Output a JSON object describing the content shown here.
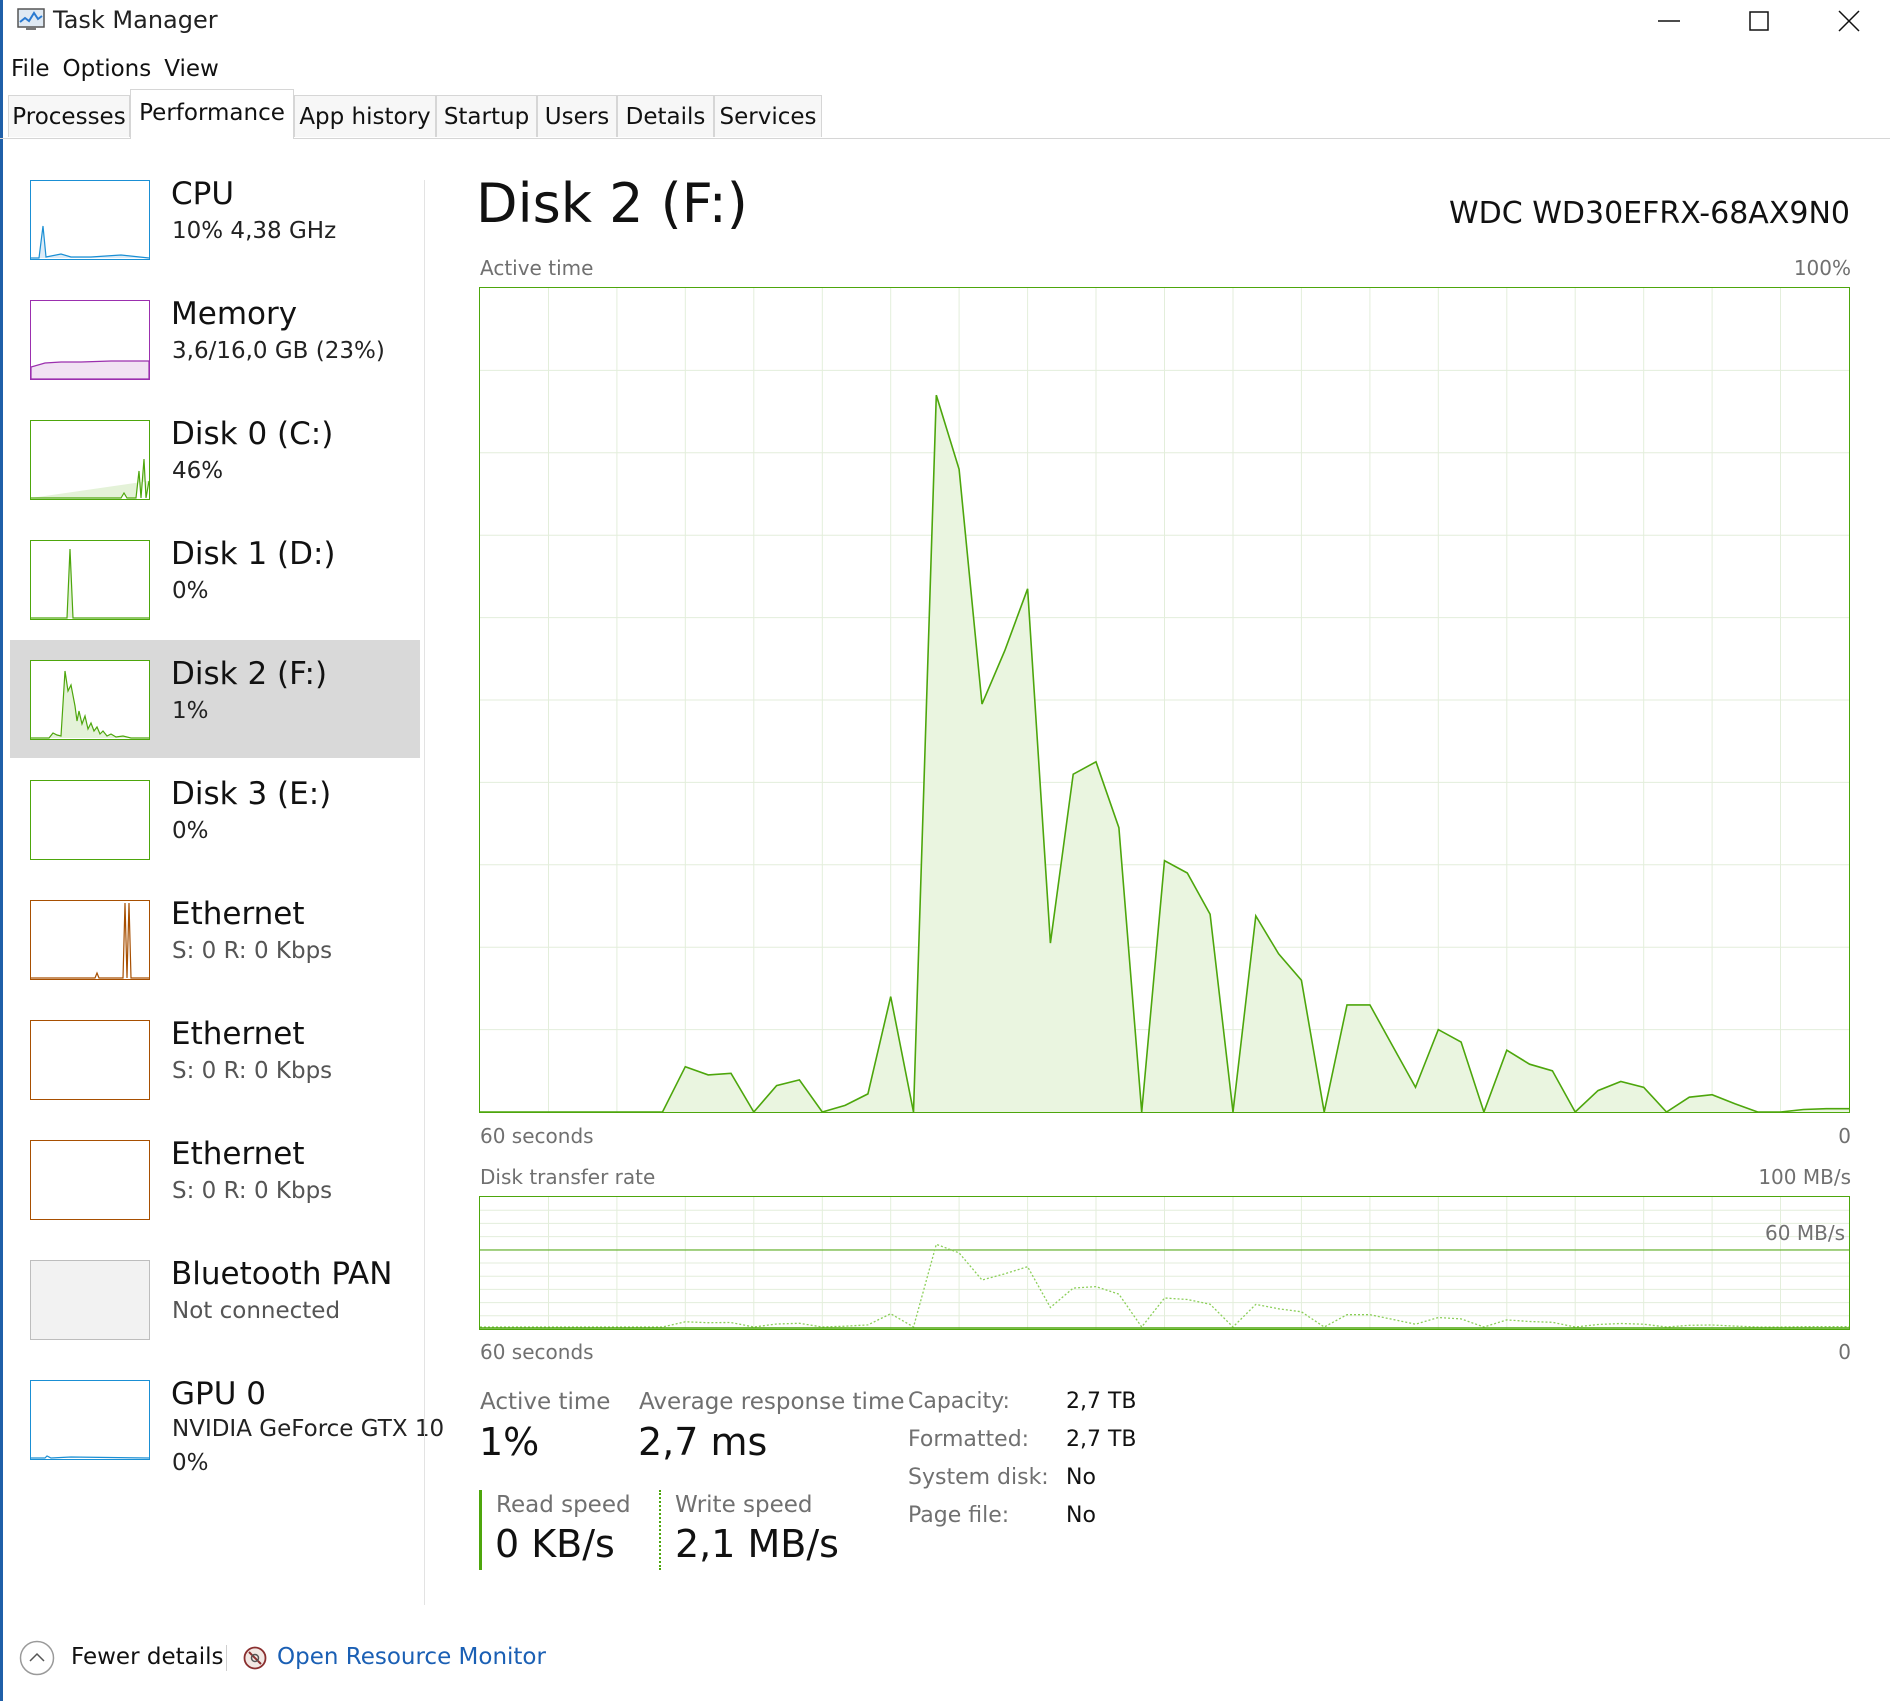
{
  "window": {
    "title": "Task Manager"
  },
  "menu": [
    "File",
    "Options",
    "View"
  ],
  "tabs": [
    {
      "label": "Processes"
    },
    {
      "label": "Performance"
    },
    {
      "label": "App history"
    },
    {
      "label": "Startup"
    },
    {
      "label": "Users"
    },
    {
      "label": "Details"
    },
    {
      "label": "Services"
    }
  ],
  "active_tab": "Performance",
  "sidebar": [
    {
      "name": "CPU",
      "sub": "10%  4,38 GHz",
      "color": "#1a8fd4"
    },
    {
      "name": "Memory",
      "sub": "3,6/16,0 GB (23%)",
      "color": "#9b2fae"
    },
    {
      "name": "Disk 0 (C:)",
      "sub": "46%",
      "color": "#4da60c"
    },
    {
      "name": "Disk 1 (D:)",
      "sub": "0%",
      "color": "#4da60c"
    },
    {
      "name": "Disk 2 (F:)",
      "sub": "1%",
      "color": "#4da60c",
      "selected": true
    },
    {
      "name": "Disk 3 (E:)",
      "sub": "0%",
      "color": "#4da60c"
    },
    {
      "name": "Ethernet",
      "sub": "S:  0  R:  0 Kbps",
      "color": "#a74f01"
    },
    {
      "name": "Ethernet",
      "sub": "S:  0  R:  0 Kbps",
      "color": "#a74f01"
    },
    {
      "name": "Ethernet",
      "sub": "S:  0  R:  0 Kbps",
      "color": "#a74f01"
    },
    {
      "name": "Bluetooth PAN",
      "sub": "Not connected",
      "color": "#a0a0a0"
    },
    {
      "name": "GPU 0",
      "sub": "NVIDIA GeForce GTX 10",
      "sub2": "0%",
      "color": "#1a8fd4"
    }
  ],
  "main": {
    "title": "Disk 2 (F:)",
    "device": "WDC WD30EFRX-68AX9N0",
    "active_graph": {
      "label": "Active time",
      "max": "100%",
      "time": "60 seconds",
      "zero": "0"
    },
    "transfer_graph": {
      "label": "Disk transfer rate",
      "max": "100 MB/s",
      "mid": "60 MB/s",
      "time": "60 seconds",
      "zero": "0"
    }
  },
  "stats": {
    "active_time": {
      "label": "Active time",
      "value": "1%"
    },
    "avg_response": {
      "label": "Average response time",
      "value": "2,7 ms"
    },
    "read_speed": {
      "label": "Read speed",
      "value": "0 KB/s"
    },
    "write_speed": {
      "label": "Write speed",
      "value": "2,1 MB/s"
    },
    "props": [
      {
        "label": "Capacity:",
        "value": "2,7 TB"
      },
      {
        "label": "Formatted:",
        "value": "2,7 TB"
      },
      {
        "label": "System disk:",
        "value": "No"
      },
      {
        "label": "Page file:",
        "value": "No"
      }
    ]
  },
  "footer": {
    "fewer": "Fewer details",
    "resource_monitor": "Open Resource Monitor"
  },
  "chart_data": {
    "type": "area",
    "title": "Active time",
    "x_range": [
      60,
      0
    ],
    "ylim": [
      0,
      100
    ],
    "grid": true,
    "y": [
      0,
      0,
      0,
      0,
      0,
      0,
      0,
      0,
      0,
      5.5,
      4.5,
      4.7,
      0,
      3.2,
      3.9,
      0,
      0.8,
      2.2,
      14,
      0,
      87,
      78,
      49.5,
      56,
      63.5,
      20.5,
      41,
      42.5,
      34.5,
      0,
      30.5,
      29,
      24,
      0,
      23.8,
      19.2,
      16,
      0,
      13,
      13,
      8,
      3,
      10,
      8.5,
      0,
      7.5,
      5.8,
      5,
      0,
      2.6,
      3.7,
      3,
      0,
      1.8,
      2.1,
      1,
      0,
      0,
      0.3,
      0.4,
      0.4
    ]
  }
}
